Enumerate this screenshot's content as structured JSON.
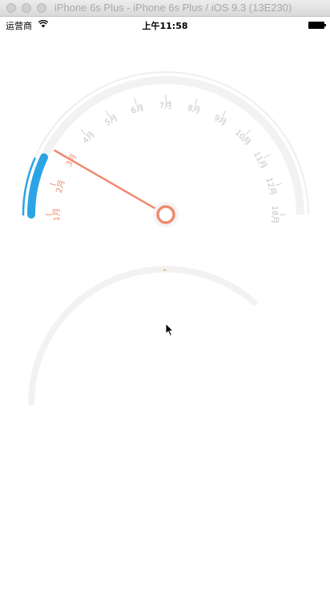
{
  "window": {
    "title": "iPhone 6s Plus - iPhone 6s Plus / iOS 9.3 (13E230)"
  },
  "status_bar": {
    "carrier": "运营商",
    "time": "上午11:58"
  },
  "gauge": {
    "month_labels": [
      "1月",
      "2月",
      "3月",
      "4月",
      "5月",
      "6月",
      "7月",
      "8月",
      "9月",
      "10月",
      "11月",
      "12月",
      "18月"
    ],
    "active_labels_count": 3,
    "selected_label": "3月",
    "needle_label_value": "3月",
    "progress_fraction": 0.14,
    "colors": {
      "accent": "#f08a6e",
      "progress": "#2ba4e5",
      "track": "#f2f2f2",
      "muted_label": "#c4c4c4"
    }
  },
  "lower_gauge": {
    "arc_fraction": 0.5,
    "marker_color": "#f5a623"
  },
  "icons": {
    "wifi": "wifi-icon",
    "battery": "battery-icon",
    "cursor": "cursor-icon"
  }
}
